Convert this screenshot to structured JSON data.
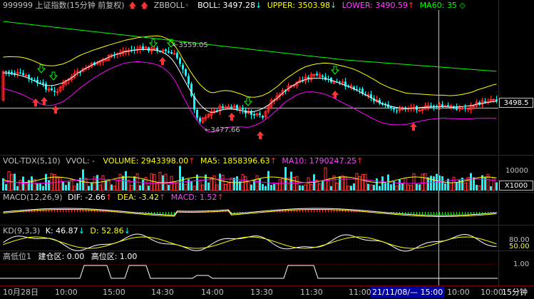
{
  "header": {
    "symbol": "999999 上证指数(15分钟 前复权)",
    "indicator": "ZBBOLL",
    "boll_label": "BOLL: 3497.28",
    "upper_label": "UPPER: 3503.98",
    "lower_label": "LOWER: 3490.59",
    "ma60_label": "MA60: 35"
  },
  "price_panel": {
    "high_marker": "3559.05",
    "low_marker": "3477.66",
    "current_price": "3498.5"
  },
  "volume_panel": {
    "title": "VOL-TDX(5,10)",
    "vvol_label": "VVOL: -",
    "volume_label": "VOLUME: 2943398.00",
    "ma5_label": "MA5: 1858396.63",
    "ma10_label": "MA10: 1790247.25",
    "scale_label": "10000",
    "unit_label": "X1000"
  },
  "macd_panel": {
    "title": "MACD(12,26,9)",
    "dif_label": "DIF: -2.66",
    "dea_label": "DEA: -3.42",
    "macd_label": "MACD: 1.52"
  },
  "kd_panel": {
    "title": "KD(9,3,3)",
    "k_label": "K: 46.87",
    "d_label": "D: 52.86",
    "axis_80": "80.00",
    "axis_50": "50.00"
  },
  "level_panel": {
    "title": "高低位1",
    "build_label": "建仓区: 0.00",
    "high_label": "高位区: 1.00",
    "axis_100": "1.00"
  },
  "time_axis": {
    "date_label": "10月28日",
    "ticks": [
      "10:00",
      "15:00",
      "14:30",
      "14:00",
      "13:30",
      "11:30",
      "11:00",
      "10:00",
      "10:00"
    ],
    "cursor_label": "21/11/08/— 15:00",
    "period_label": "15分钟"
  },
  "colors": {
    "up": "#ff3333",
    "down": "#00ffff",
    "boll_mid": "#ffffff",
    "upper": "#ffff00",
    "lower": "#ff00ff",
    "ma60": "#00ff00"
  },
  "icons": {
    "indicator_toggle": "circle-icon",
    "boll_arrow": "down-arrow-icon",
    "upper_arrow": "down-arrow-icon",
    "lower_arrow": "up-arrow-icon",
    "ma60_diamond": "diamond-icon"
  }
}
